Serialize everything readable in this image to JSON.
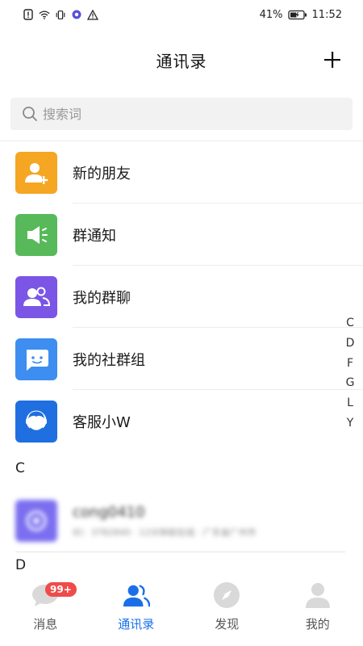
{
  "status_bar": {
    "battery": "41%",
    "time": "11:52"
  },
  "header": {
    "title": "通讯录",
    "add_label": "+"
  },
  "search": {
    "placeholder": "搜索词"
  },
  "entries": [
    {
      "label": "新的朋友",
      "color": "#f5a623",
      "icon": "add-friend-icon"
    },
    {
      "label": "群通知",
      "color": "#58b95a",
      "icon": "speaker-icon"
    },
    {
      "label": "我的群聊",
      "color": "#7a55e6",
      "icon": "group-icon"
    },
    {
      "label": "我的社群组",
      "color": "#3d8ef0",
      "icon": "chat-face-icon"
    },
    {
      "label": "客服小W",
      "color": "#1f6fe0",
      "icon": "customer-service-icon"
    }
  ],
  "sections": {
    "c": "C",
    "d": "D"
  },
  "contact": {
    "name": "cong0410",
    "sub": "ID：3782840 · 12分钟前在线 · 广东省广州市"
  },
  "index": [
    "C",
    "D",
    "F",
    "G",
    "L",
    "Y"
  ],
  "tabs": [
    {
      "label": "消息",
      "badge": "99+"
    },
    {
      "label": "通讯录"
    },
    {
      "label": "发现"
    },
    {
      "label": "我的"
    }
  ],
  "colors": {
    "accent": "#1a6fe8",
    "badge": "#f04b4b"
  }
}
